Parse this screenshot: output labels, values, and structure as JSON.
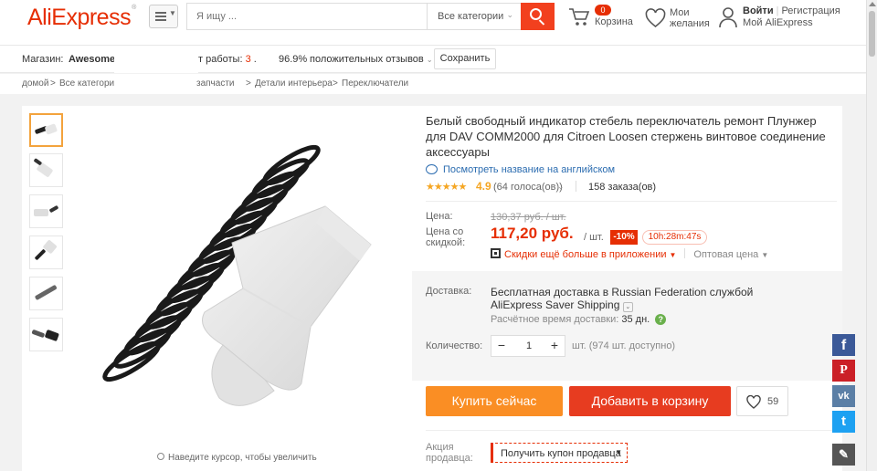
{
  "header": {
    "logo": "AliExpress",
    "logo_mark": "®",
    "search_placeholder": "Я ищу ...",
    "search_category": "Все категории",
    "cart_count": "0",
    "cart_label": "Корзина",
    "wish_line1": "Мои",
    "wish_line2": "желания",
    "login": "Войти",
    "register": "Регистрация",
    "my_ali": "Мой AliExpress"
  },
  "store": {
    "store_label": "Магазин:",
    "store_name": "Awesome",
    "years_label": "т работы:",
    "years_value": "3",
    "years_suffix": ".",
    "rating": "96.9%",
    "positive_label": "положительных отзывов",
    "save_label": "Сохранить"
  },
  "breadcrumbs": {
    "home": "домой",
    "sep": ">",
    "all": "Все категори",
    "spare": "запчасти",
    "interior": "Детали интерьера",
    "switches": "Переключатели"
  },
  "gallery": {
    "zoom_hint": "Наведите курсор, чтобы увеличить"
  },
  "product": {
    "title": "Белый свободный индикатор стебель переключатель ремонт Плунжер для DAV COMM2000 для Citroen Loosen стержень винтовое соединение аксессуары",
    "translate_link": "Посмотреть название на английском",
    "stars": "★★★★★",
    "rating": "4.9",
    "votes": "(64 голоса(ов))",
    "orders": "158 заказа(ов)",
    "price_label": "Цена:",
    "old_price": "130,37 руб. / шт.",
    "discount_price_label_1": "Цена со",
    "discount_price_label_2": "скидкой:",
    "price": "117,20 руб.",
    "per_piece": "/ шт.",
    "discount": "-10%",
    "timer": "10h:28m:47s",
    "app_promo": "Скидки ещё больше в приложении",
    "wholesale": "Оптовая цена"
  },
  "shipping": {
    "label": "Доставка:",
    "line1": "Бесплатная доставка в Russian Federation службой",
    "line2": "AliExpress Saver Shipping",
    "est_label": "Расчётное время доставки:",
    "est_value": "35 дн.",
    "qty_label": "Количество:",
    "qty_value": "1",
    "available": "шт. (974 шт. доступно)"
  },
  "actions": {
    "buy_now": "Купить сейчас",
    "add_to_cart": "Добавить в корзину",
    "wish_count": "59"
  },
  "seller_promo": {
    "label_1": "Акция",
    "label_2": "продавца:",
    "coupon": "Получить купон продавца"
  },
  "social": {
    "facebook": "f",
    "pinterest": "P",
    "vk": "vk",
    "twitter": "t"
  },
  "colors": {
    "brand": "#e62e04",
    "buy_now": "#fa8e24",
    "add_to_cart": "#e73c20",
    "facebook": "#3b5998",
    "pinterest": "#cb2027",
    "vk": "#5b7fa6",
    "twitter": "#1da1f2"
  }
}
